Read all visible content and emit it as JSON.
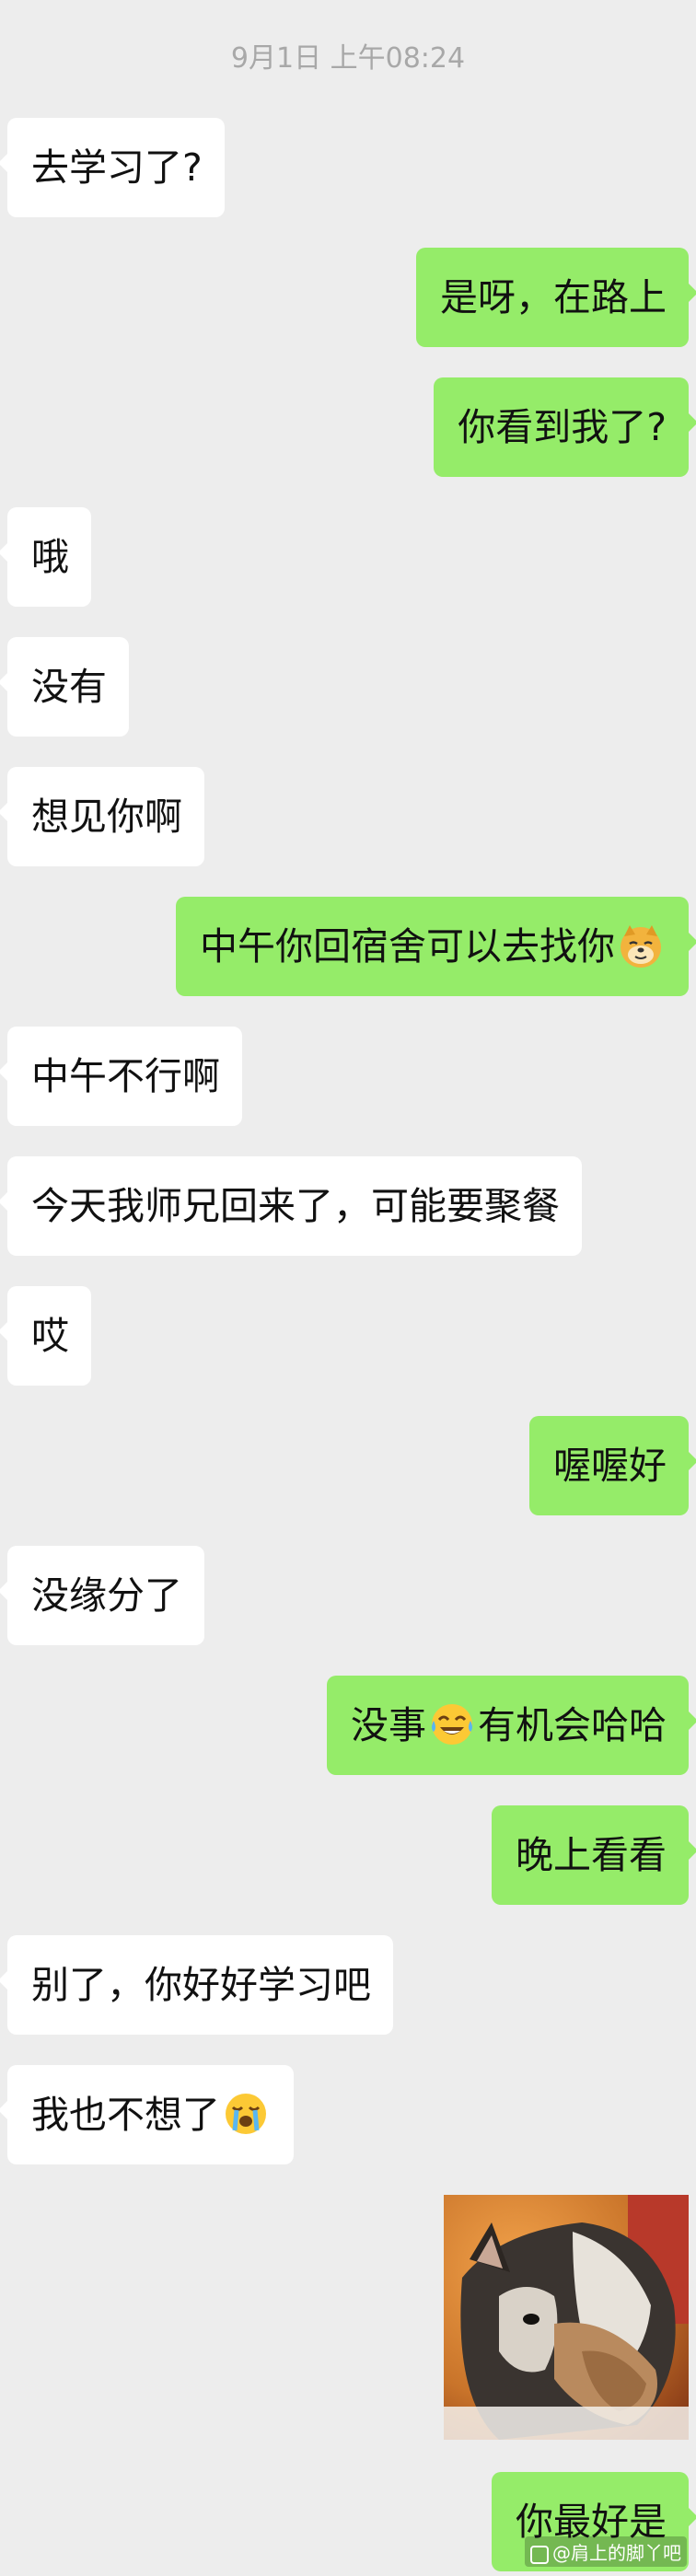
{
  "timestamp": "9月1日 上午08:24",
  "messages": [
    {
      "side": "in",
      "text": "去学习了?"
    },
    {
      "side": "out",
      "text": "是呀，在路上"
    },
    {
      "side": "out",
      "text": "你看到我了?"
    },
    {
      "side": "in",
      "text": "哦"
    },
    {
      "side": "in",
      "text": "没有"
    },
    {
      "side": "in",
      "text": "想见你啊"
    },
    {
      "side": "out",
      "text": "中午你回宿舍可以去找你",
      "emoji_after": "doge-emoji"
    },
    {
      "side": "in",
      "text": "中午不行啊"
    },
    {
      "side": "in",
      "text": "今天我师兄回来了，可能要聚餐"
    },
    {
      "side": "in",
      "text": "哎"
    },
    {
      "side": "out",
      "text": "喔喔好"
    },
    {
      "side": "in",
      "text": "没缘分了"
    },
    {
      "side": "out",
      "text_before": "没事",
      "emoji_mid": "tears-of-joy-emoji",
      "text_after": "有机会哈哈"
    },
    {
      "side": "out",
      "text": "晚上看看"
    },
    {
      "side": "in",
      "text": "别了，你好好学习吧"
    },
    {
      "side": "in",
      "text": "我也不想了",
      "emoji_after": "crying-emoji"
    },
    {
      "side": "out",
      "type": "image",
      "image": "husky-dog-sticker"
    },
    {
      "side": "out",
      "text": "你最好是"
    }
  ],
  "watermark": {
    "text": "@肩上的脚丫吧"
  },
  "colors": {
    "background": "#ededed",
    "incoming_bubble": "#ffffff",
    "outgoing_bubble": "#95ec69",
    "timestamp": "#a8a8a8"
  }
}
